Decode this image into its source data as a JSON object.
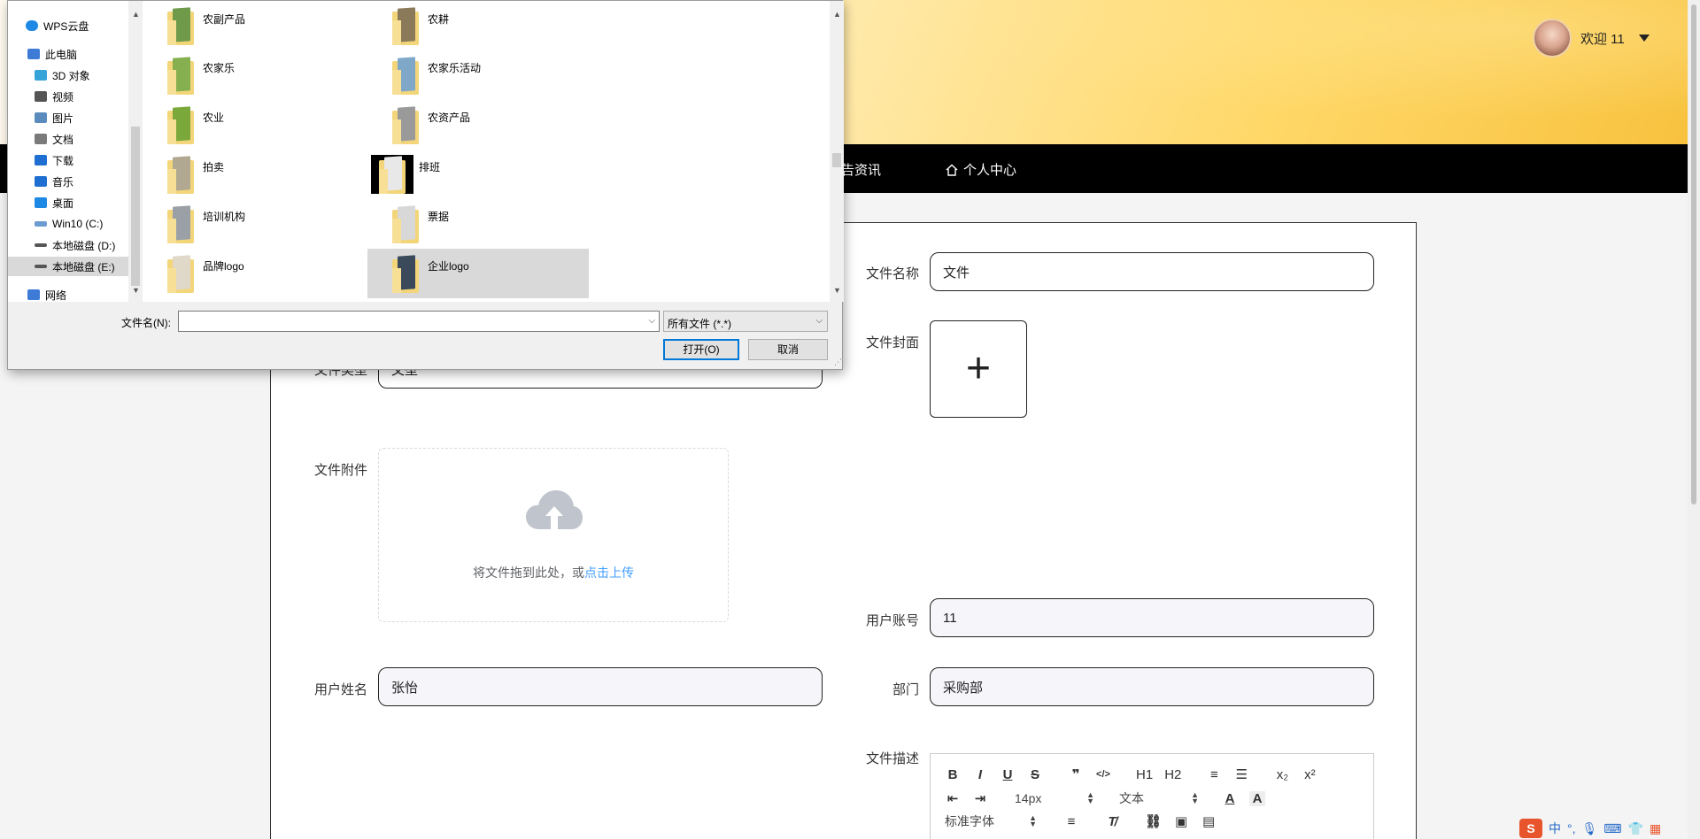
{
  "header": {
    "welcome_text": "欢迎 11"
  },
  "nav": {
    "news_label": "告资讯",
    "personal_label": "个人中心"
  },
  "form": {
    "file_name_label": "文件名称",
    "file_name_value": "文件",
    "file_cover_label": "文件封面",
    "file_type_label": "文件类型",
    "file_type_value": "文型",
    "file_attachment_label": "文件附件",
    "upload_text": "将文件拖到此处，或",
    "upload_link": "点击上传",
    "user_account_label": "用户账号",
    "user_account_value": "11",
    "user_name_label": "用户姓名",
    "user_name_value": "张怡",
    "department_label": "部门",
    "department_value": "采购部",
    "file_desc_label": "文件描述"
  },
  "editor": {
    "row1": [
      "B",
      "I",
      "U",
      "S",
      "❞",
      "</>",
      "H1",
      "H2",
      "≡",
      "☰",
      "x₂",
      "x²"
    ],
    "font_size": "14px",
    "text_type": "文本",
    "font_family": "标准字体"
  },
  "dialog": {
    "nav_items": [
      {
        "label": "WPS云盘",
        "color": "#1e88e5"
      },
      {
        "label": "此电脑",
        "color": "#3d7bd6"
      },
      {
        "label": "3D 对象",
        "color": "#36a3d9"
      },
      {
        "label": "视频",
        "color": "#555555"
      },
      {
        "label": "图片",
        "color": "#5a8bbd"
      },
      {
        "label": "文档",
        "color": "#7a7a7a"
      },
      {
        "label": "下载",
        "color": "#1e6fd1"
      },
      {
        "label": "音乐",
        "color": "#1e6fd1"
      },
      {
        "label": "桌面",
        "color": "#1e88e5"
      },
      {
        "label": "Win10 (C:)",
        "color": "#6b9bd1"
      },
      {
        "label": "本地磁盘 (D:)",
        "color": "#555555"
      },
      {
        "label": "本地磁盘 (E:)",
        "color": "#555555"
      },
      {
        "label": "网络",
        "color": "#3d7bd6"
      }
    ],
    "files": [
      {
        "name": "农副产品",
        "photo": "#6f9a4a"
      },
      {
        "name": "农耕",
        "photo": "#8a7a5a"
      },
      {
        "name": "农家乐",
        "photo": "#86b050"
      },
      {
        "name": "农家乐活动",
        "photo": "#7fa8c8"
      },
      {
        "name": "农业",
        "photo": "#7aa83a"
      },
      {
        "name": "农资产品",
        "photo": "#9a9a9a"
      },
      {
        "name": "拍卖",
        "photo": "#b0a890"
      },
      {
        "name": "排班",
        "photo": "#e8e8e8"
      },
      {
        "name": "培训机构",
        "photo": "#9aa0a6"
      },
      {
        "name": "票据",
        "photo": "#d8d8d8"
      },
      {
        "name": "品牌logo",
        "photo": "#e0d8c8"
      },
      {
        "name": "企业logo",
        "photo": "#3a4a5a"
      }
    ],
    "filename_label": "文件名(N):",
    "filename_value": "",
    "type_filter": "所有文件 (*.*)",
    "open_label": "打开(O)",
    "cancel_label": "取消"
  },
  "ime": {
    "logo": "S",
    "mode": "中"
  }
}
